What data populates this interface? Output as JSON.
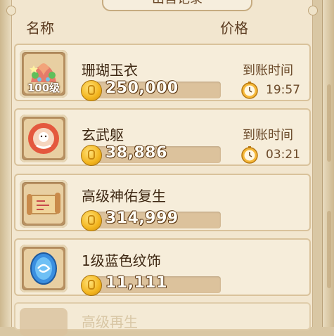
{
  "panel": {
    "title": "出售记录",
    "header_name": "名称",
    "header_price": "价格"
  },
  "items": [
    {
      "name": "珊瑚玉衣",
      "level": "100级",
      "price": "250,000",
      "arrive_label": "到账时间",
      "arrive_time": "19:57",
      "icon": "coral-robe-icon"
    },
    {
      "name": "玄武躯",
      "price": "38,886",
      "arrive_label": "到账时间",
      "arrive_time": "03:21",
      "icon": "pet-egg-icon"
    },
    {
      "name": "高级神佑复生",
      "price": "314,999",
      "icon": "scroll-icon"
    },
    {
      "name": "1级蓝色纹饰",
      "price": "11,111",
      "icon": "blue-gem-icon"
    }
  ],
  "partial_item": {
    "name": "高级再生"
  },
  "colors": {
    "panel_bg": "#f2e6cf",
    "row_bg": "#f6edda",
    "price_bar": "#dcc29c",
    "coin": "#f3b51e",
    "text_dark": "#3d2712"
  }
}
